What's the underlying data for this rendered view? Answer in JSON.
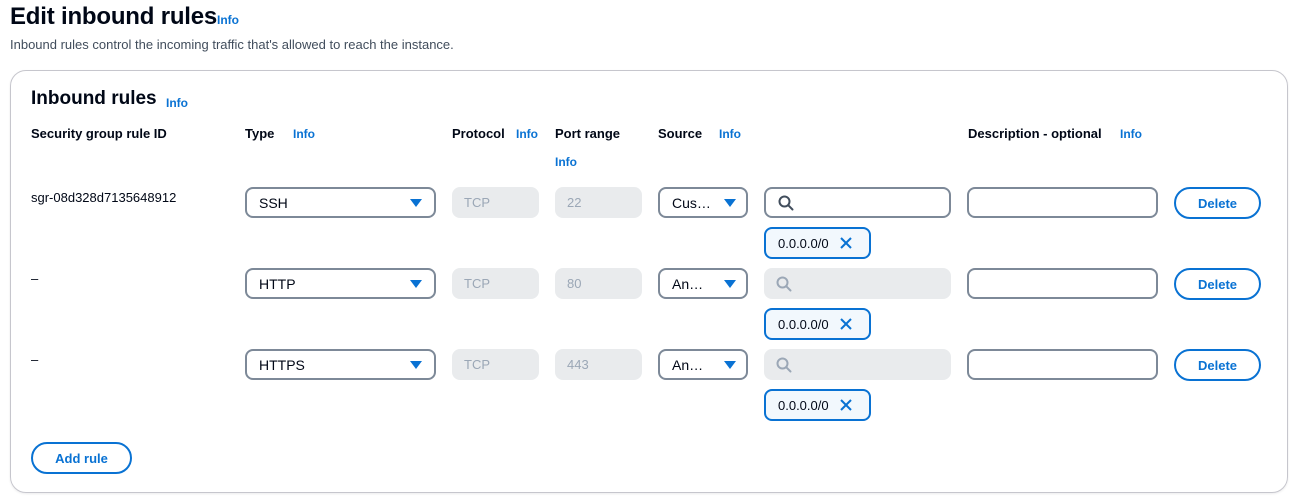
{
  "page": {
    "title": "Edit inbound rules",
    "info": "Info",
    "description": "Inbound rules control the incoming traffic that's allowed to reach the instance."
  },
  "panel": {
    "title": "Inbound rules",
    "info": "Info",
    "add_rule": "Add rule"
  },
  "columns": {
    "rule_id": "Security group rule ID",
    "type": "Type",
    "type_info": "Info",
    "protocol": "Protocol",
    "protocol_info": "Info",
    "port_range": "Port range",
    "port_range_info": "Info",
    "source": "Source",
    "source_info": "Info",
    "description": "Description - optional",
    "description_info": "Info"
  },
  "rules": [
    {
      "id": "sgr-08d328d7135648912",
      "type": "SSH",
      "protocol": "TCP",
      "port": "22",
      "source": "Cus…",
      "cidr": "0.0.0.0/0",
      "delete": "Delete"
    },
    {
      "id": "–",
      "type": "HTTP",
      "protocol": "TCP",
      "port": "80",
      "source": "An…",
      "cidr": "0.0.0.0/0",
      "delete": "Delete"
    },
    {
      "id": "–",
      "type": "HTTPS",
      "protocol": "TCP",
      "port": "443",
      "source": "An…",
      "cidr": "0.0.0.0/0",
      "delete": "Delete"
    }
  ],
  "colors": {
    "accent": "#0972d3",
    "border": "#7d8998",
    "disabled_bg": "#e9ebed"
  }
}
